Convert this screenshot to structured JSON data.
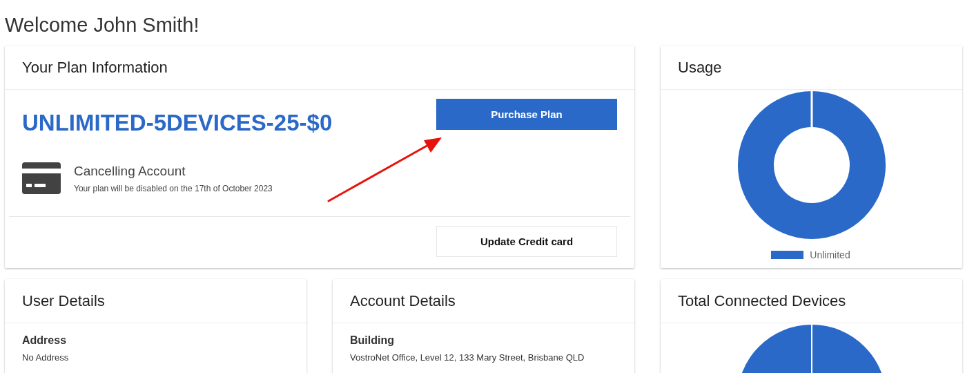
{
  "page_title": "Welcome John Smith!",
  "plan": {
    "title": "Your Plan Information",
    "plan_name": "UNLIMITED-5DEVICES-25-$0",
    "purchase_button": "Purchase Plan",
    "status": "Cancelling Account",
    "status_note": "Your plan will be disabled on the 17th of October 2023",
    "update_button": "Update Credit card"
  },
  "usage": {
    "title": "Usage",
    "legend": [
      {
        "label": "Unlimited",
        "color": "#2a69c7"
      }
    ]
  },
  "user_details": {
    "title": "User Details",
    "fields": [
      {
        "label": "Address",
        "value": "No Address"
      }
    ]
  },
  "account_details": {
    "title": "Account Details",
    "fields": [
      {
        "label": "Building",
        "value": "VostroNet Office, Level 12, 133 Mary Street, Brisbane QLD"
      }
    ]
  },
  "devices": {
    "title": "Total Connected Devices"
  }
}
